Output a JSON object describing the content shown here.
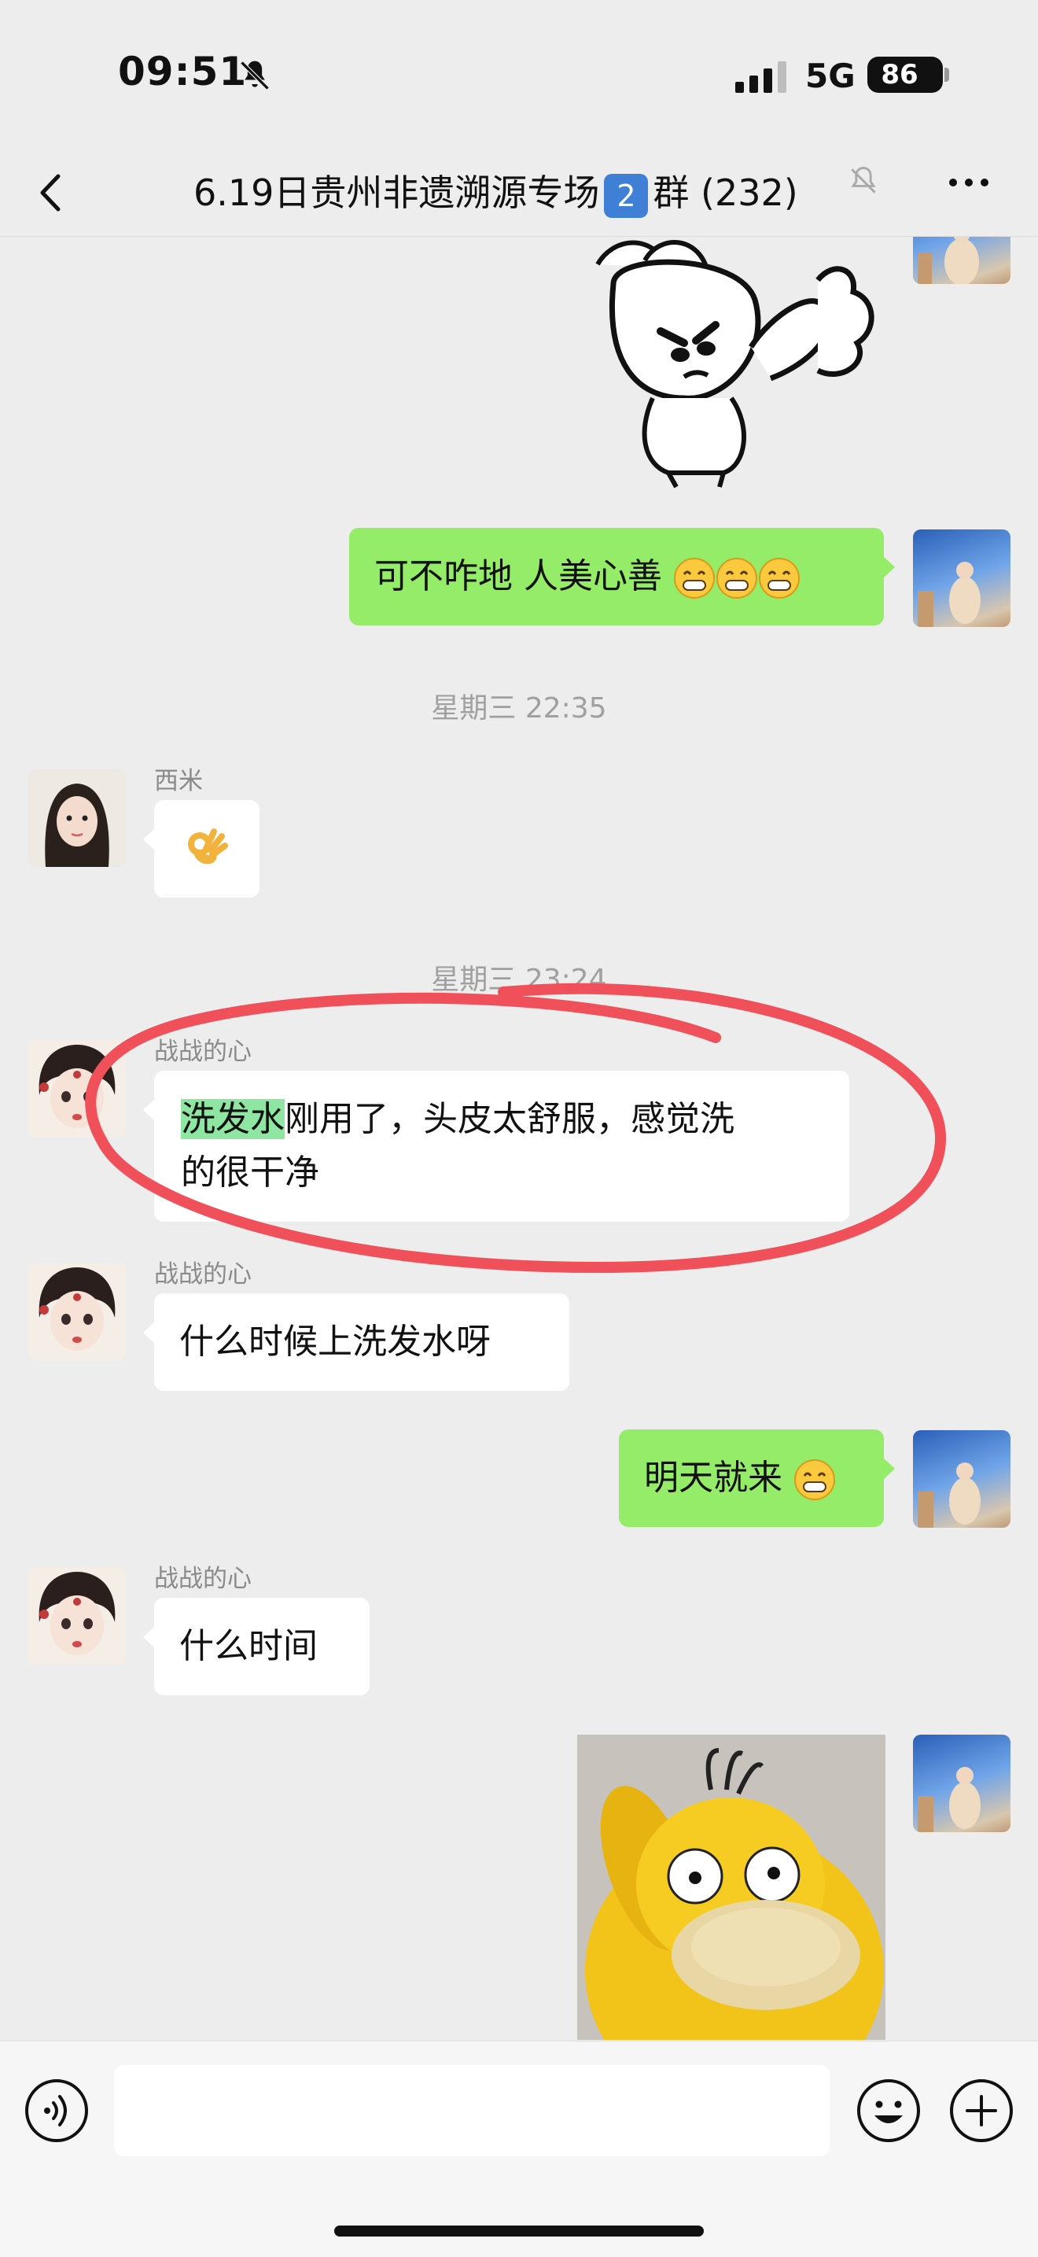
{
  "status_bar": {
    "time": "09:51",
    "network": "5G",
    "battery": "86"
  },
  "header": {
    "title_before": "6.19日贵州非遗溯源专场",
    "title_badge": "2",
    "title_after": "群 (232)"
  },
  "messages": [
    {
      "type": "sticker",
      "direction": "outgoing",
      "sticker": "angry rabbit thumbs-up sticker"
    },
    {
      "type": "text",
      "direction": "outgoing",
      "text": "可不咋地 人美心善",
      "emoji": [
        "grin-emoji",
        "grin-emoji",
        "grin-emoji"
      ]
    },
    {
      "type": "timestamp",
      "text": "星期三 22:35"
    },
    {
      "type": "text",
      "direction": "incoming",
      "sender": "西米",
      "emoji": [
        "ok-hand-emoji"
      ]
    },
    {
      "type": "timestamp",
      "text": "星期三 23:24"
    },
    {
      "type": "text",
      "direction": "incoming",
      "sender": "战战的心",
      "highlight": "洗发水",
      "text_line1_rest": "刚用了，头皮太舒服，感觉洗",
      "text_line2": "的很干净",
      "annotation": "red hand-drawn circle"
    },
    {
      "type": "text",
      "direction": "incoming",
      "sender": "战战的心",
      "text": "什么时候上洗发水呀"
    },
    {
      "type": "text",
      "direction": "outgoing",
      "text": "明天就来",
      "emoji": [
        "grin-emoji"
      ]
    },
    {
      "type": "text",
      "direction": "incoming",
      "sender": "战战的心",
      "text": "什么时间"
    },
    {
      "type": "sticker",
      "direction": "outgoing",
      "sticker": "yellow duck sticker"
    }
  ],
  "input_bar": {
    "placeholder": "",
    "icons": [
      "voice-icon",
      "emoji-icon",
      "plus-icon"
    ]
  },
  "colors": {
    "background": "#EDEDED",
    "outgoing_bubble": "#95EC69",
    "incoming_bubble": "#FFFFFF",
    "highlight": "#8EE6A2",
    "annotation": "#F0505A"
  }
}
